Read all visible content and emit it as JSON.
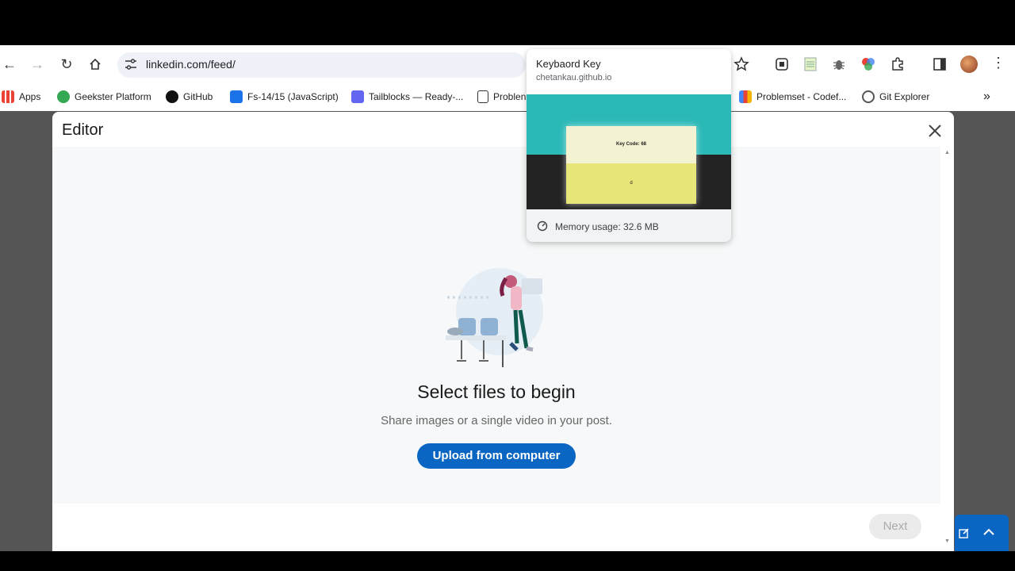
{
  "browser": {
    "url": "linkedin.com/feed/",
    "bookmarks": [
      {
        "label": "Apps",
        "icon": "apps-grid-icon",
        "color": "#4285f4"
      },
      {
        "label": "Geekster Platform",
        "icon": "geekster-icon",
        "color": "#34a853"
      },
      {
        "label": "GitHub",
        "icon": "github-icon",
        "color": "#111111"
      },
      {
        "label": "Fs-14/15 (JavaScript)",
        "icon": "classroom-icon",
        "color": "#1a73e8"
      },
      {
        "label": "Tailblocks — Ready-...",
        "icon": "tailblocks-icon",
        "color": "#6366f1"
      },
      {
        "label": "Problen",
        "icon": "codeforces-icon",
        "color": "#333333"
      },
      {
        "label": "Problemset - Codef...",
        "icon": "bar-chart-icon",
        "color": "#f4b400"
      },
      {
        "label": "Git Explorer",
        "icon": "git-explorer-icon",
        "color": "#555555"
      }
    ]
  },
  "tab_hover_card": {
    "title": "Keybaord Key",
    "domain": "chetankau.github.io",
    "preview_top_text": "Key Code: 68",
    "preview_bottom_text": "d",
    "memory": "Memory usage: 32.6 MB"
  },
  "editor": {
    "title": "Editor",
    "heading": "Select files to begin",
    "subtext": "Share images or a single video in your post.",
    "upload_label": "Upload from computer",
    "next_label": "Next"
  },
  "colors": {
    "accent": "#0a66c2",
    "hover_teal": "#2ab9b7"
  }
}
